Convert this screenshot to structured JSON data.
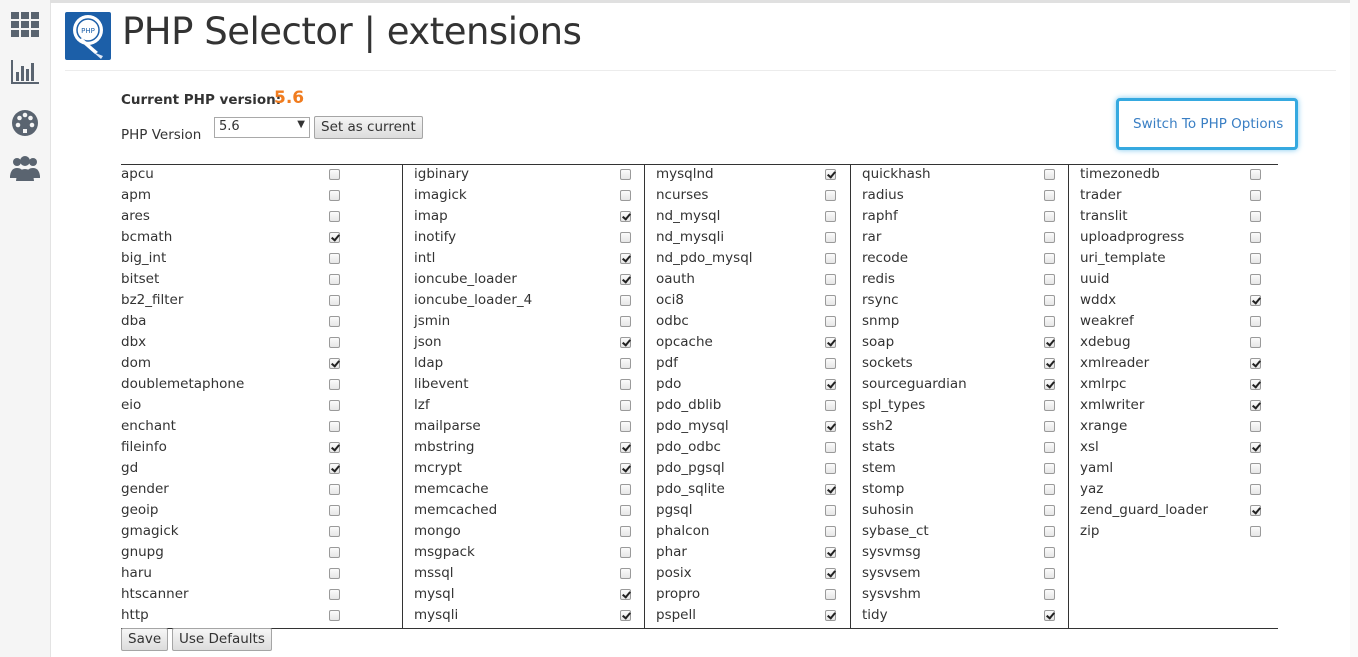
{
  "sidebar": {
    "icons": [
      "apps-grid-icon",
      "stats-chart-icon",
      "dashboard-palette-icon",
      "users-icon"
    ]
  },
  "header": {
    "title": "PHP Selector | extensions"
  },
  "version": {
    "current_label": "Current PHP version:",
    "current_value": "5.6",
    "select_label": "PHP Version",
    "selected": "5.6",
    "set_current_label": "Set as current"
  },
  "switch_link": "Switch To PHP Options",
  "columns": [
    [
      {
        "name": "apcu",
        "checked": false
      },
      {
        "name": "apm",
        "checked": false
      },
      {
        "name": "ares",
        "checked": false
      },
      {
        "name": "bcmath",
        "checked": true
      },
      {
        "name": "big_int",
        "checked": false
      },
      {
        "name": "bitset",
        "checked": false
      },
      {
        "name": "bz2_filter",
        "checked": false
      },
      {
        "name": "dba",
        "checked": false
      },
      {
        "name": "dbx",
        "checked": false
      },
      {
        "name": "dom",
        "checked": true
      },
      {
        "name": "doublemetaphone",
        "checked": false
      },
      {
        "name": "eio",
        "checked": false
      },
      {
        "name": "enchant",
        "checked": false
      },
      {
        "name": "fileinfo",
        "checked": true
      },
      {
        "name": "gd",
        "checked": true
      },
      {
        "name": "gender",
        "checked": false
      },
      {
        "name": "geoip",
        "checked": false
      },
      {
        "name": "gmagick",
        "checked": false
      },
      {
        "name": "gnupg",
        "checked": false
      },
      {
        "name": "haru",
        "checked": false
      },
      {
        "name": "htscanner",
        "checked": false
      },
      {
        "name": "http",
        "checked": false
      }
    ],
    [
      {
        "name": "igbinary",
        "checked": false
      },
      {
        "name": "imagick",
        "checked": false
      },
      {
        "name": "imap",
        "checked": true
      },
      {
        "name": "inotify",
        "checked": false
      },
      {
        "name": "intl",
        "checked": true
      },
      {
        "name": "ioncube_loader",
        "checked": true
      },
      {
        "name": "ioncube_loader_4",
        "checked": false
      },
      {
        "name": "jsmin",
        "checked": false
      },
      {
        "name": "json",
        "checked": true
      },
      {
        "name": "ldap",
        "checked": false
      },
      {
        "name": "libevent",
        "checked": false
      },
      {
        "name": "lzf",
        "checked": false
      },
      {
        "name": "mailparse",
        "checked": false
      },
      {
        "name": "mbstring",
        "checked": true
      },
      {
        "name": "mcrypt",
        "checked": true
      },
      {
        "name": "memcache",
        "checked": false
      },
      {
        "name": "memcached",
        "checked": false
      },
      {
        "name": "mongo",
        "checked": false
      },
      {
        "name": "msgpack",
        "checked": false
      },
      {
        "name": "mssql",
        "checked": false
      },
      {
        "name": "mysql",
        "checked": true
      },
      {
        "name": "mysqli",
        "checked": true
      }
    ],
    [
      {
        "name": "mysqlnd",
        "checked": true
      },
      {
        "name": "ncurses",
        "checked": false
      },
      {
        "name": "nd_mysql",
        "checked": false
      },
      {
        "name": "nd_mysqli",
        "checked": false
      },
      {
        "name": "nd_pdo_mysql",
        "checked": false
      },
      {
        "name": "oauth",
        "checked": false
      },
      {
        "name": "oci8",
        "checked": false
      },
      {
        "name": "odbc",
        "checked": false
      },
      {
        "name": "opcache",
        "checked": true
      },
      {
        "name": "pdf",
        "checked": false
      },
      {
        "name": "pdo",
        "checked": true
      },
      {
        "name": "pdo_dblib",
        "checked": false
      },
      {
        "name": "pdo_mysql",
        "checked": true
      },
      {
        "name": "pdo_odbc",
        "checked": false
      },
      {
        "name": "pdo_pgsql",
        "checked": false
      },
      {
        "name": "pdo_sqlite",
        "checked": true
      },
      {
        "name": "pgsql",
        "checked": false
      },
      {
        "name": "phalcon",
        "checked": false
      },
      {
        "name": "phar",
        "checked": true
      },
      {
        "name": "posix",
        "checked": true
      },
      {
        "name": "propro",
        "checked": false
      },
      {
        "name": "pspell",
        "checked": true
      }
    ],
    [
      {
        "name": "quickhash",
        "checked": false
      },
      {
        "name": "radius",
        "checked": false
      },
      {
        "name": "raphf",
        "checked": false
      },
      {
        "name": "rar",
        "checked": false
      },
      {
        "name": "recode",
        "checked": false
      },
      {
        "name": "redis",
        "checked": false
      },
      {
        "name": "rsync",
        "checked": false
      },
      {
        "name": "snmp",
        "checked": false
      },
      {
        "name": "soap",
        "checked": true
      },
      {
        "name": "sockets",
        "checked": true
      },
      {
        "name": "sourceguardian",
        "checked": true
      },
      {
        "name": "spl_types",
        "checked": false
      },
      {
        "name": "ssh2",
        "checked": false
      },
      {
        "name": "stats",
        "checked": false
      },
      {
        "name": "stem",
        "checked": false
      },
      {
        "name": "stomp",
        "checked": false
      },
      {
        "name": "suhosin",
        "checked": false
      },
      {
        "name": "sybase_ct",
        "checked": false
      },
      {
        "name": "sysvmsg",
        "checked": false
      },
      {
        "name": "sysvsem",
        "checked": false
      },
      {
        "name": "sysvshm",
        "checked": false
      },
      {
        "name": "tidy",
        "checked": true
      }
    ],
    [
      {
        "name": "timezonedb",
        "checked": false
      },
      {
        "name": "trader",
        "checked": false
      },
      {
        "name": "translit",
        "checked": false
      },
      {
        "name": "uploadprogress",
        "checked": false
      },
      {
        "name": "uri_template",
        "checked": false
      },
      {
        "name": "uuid",
        "checked": false
      },
      {
        "name": "wddx",
        "checked": true
      },
      {
        "name": "weakref",
        "checked": false
      },
      {
        "name": "xdebug",
        "checked": false
      },
      {
        "name": "xmlreader",
        "checked": true
      },
      {
        "name": "xmlrpc",
        "checked": true
      },
      {
        "name": "xmlwriter",
        "checked": true
      },
      {
        "name": "xrange",
        "checked": false
      },
      {
        "name": "xsl",
        "checked": true
      },
      {
        "name": "yaml",
        "checked": false
      },
      {
        "name": "yaz",
        "checked": false
      },
      {
        "name": "zend_guard_loader",
        "checked": true
      },
      {
        "name": "zip",
        "checked": false
      }
    ]
  ],
  "footer": {
    "save_label": "Save",
    "defaults_label": "Use Defaults"
  }
}
